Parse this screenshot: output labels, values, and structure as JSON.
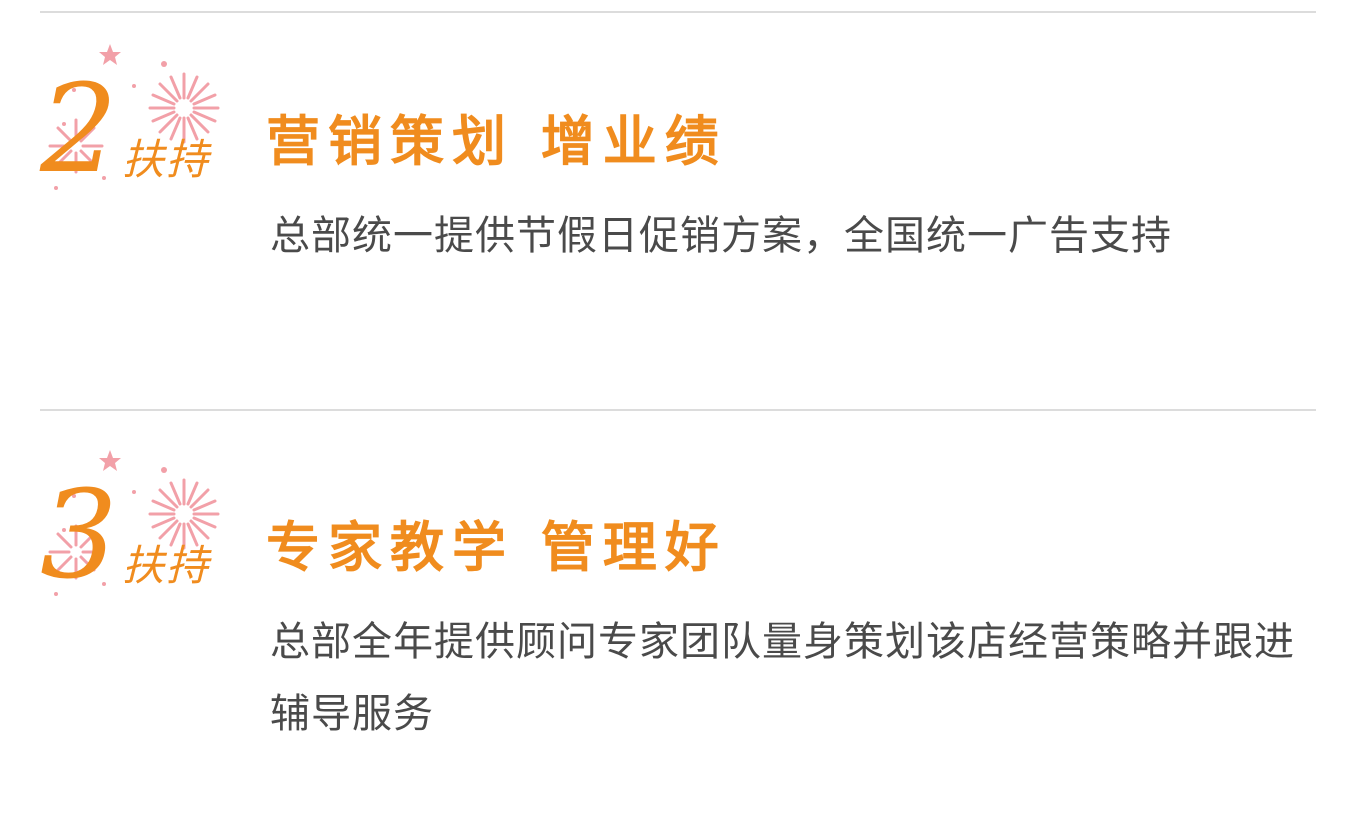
{
  "colors": {
    "accent": "#f08c1e",
    "firework": "#f2a0a8",
    "text": "#4a4a4a",
    "divider": "#dcdcdc",
    "background": "#ffffff"
  },
  "sections": [
    {
      "number": "2",
      "badge_label": "扶持",
      "headline": "营销策划  增业绩",
      "description": "总部统一提供节假日促销方案，全国统一广告支持",
      "icon": "firework-icon"
    },
    {
      "number": "3",
      "badge_label": "扶持",
      "headline": "专家教学  管理好",
      "description": "总部全年提供顾问专家团队量身策划该店经营策略并跟进辅导服务",
      "icon": "firework-icon"
    }
  ]
}
